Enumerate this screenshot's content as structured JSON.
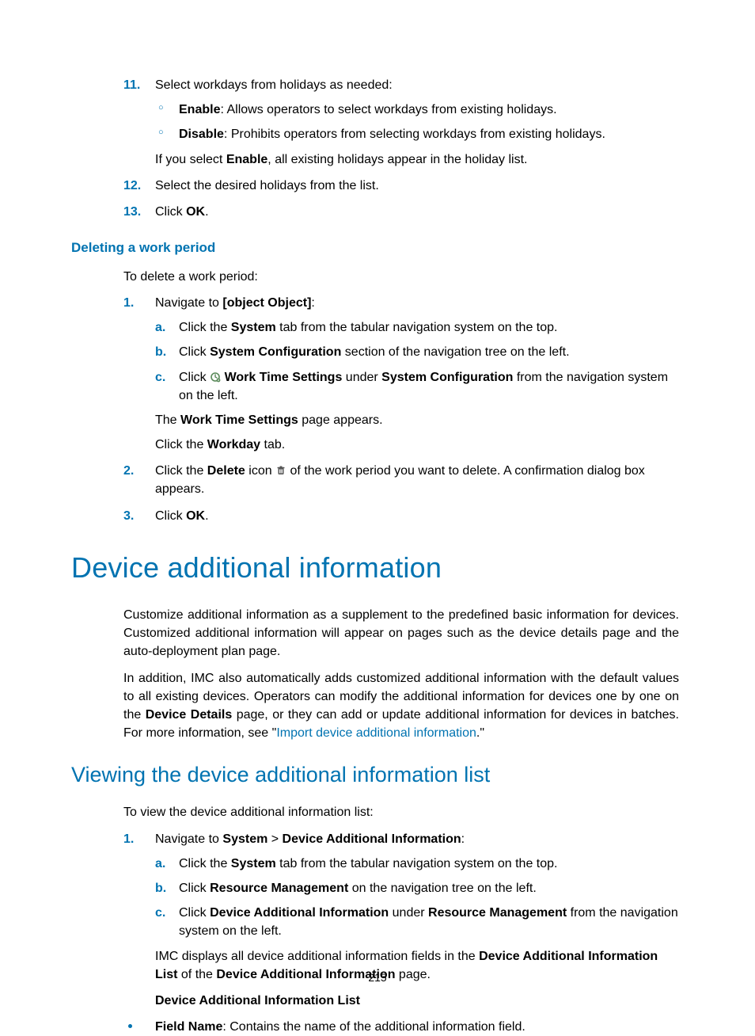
{
  "steps_top": {
    "item11": {
      "num": "11.",
      "lead": "Select workdays from holidays as needed:",
      "enable_b": "Enable",
      "enable_t": ": Allows operators to select workdays from existing holidays.",
      "disable_b": "Disable",
      "disable_t": ": Prohibits operators from selecting workdays from existing holidays.",
      "note_pre": "If you select ",
      "note_b": "Enable",
      "note_post": ", all existing holidays appear in the holiday list."
    },
    "item12": {
      "num": "12.",
      "text": "Select the desired holidays from the list."
    },
    "item13": {
      "num": "13.",
      "pre": "Click ",
      "b": "OK",
      "post": "."
    }
  },
  "deleting": {
    "heading": "Deleting a work period",
    "intro": "To delete a work period:",
    "s1": {
      "num": "1.",
      "pre": "Navigate to ",
      "b": {
        "m": "b.",
        "pre": "Click ",
        "b1": "System Configuration",
        "post": " section of the navigation tree on the left."
      },
      "post": ":",
      "a": {
        "m": "a.",
        "pre": "Click the ",
        "b": "System",
        "post": " tab from the tabular navigation system on the top."
      },
      "c": {
        "m": "c.",
        "pre": "Click ",
        "b1": "Work Time Settings",
        "mid": " under ",
        "b2": "System Configuration",
        "post": " from the navigation system on the left."
      },
      "after1_pre": "The ",
      "after1_b": "Work Time Settings",
      "after1_post": " page appears.",
      "after2_pre": "Click the ",
      "after2_b": "Workday",
      "after2_post": " tab."
    },
    "s2": {
      "num": "2.",
      "pre": "Click the ",
      "b": "Delete",
      "mid": " icon ",
      "post": " of the work period you want to delete. A confirmation dialog box appears."
    },
    "s3": {
      "num": "3.",
      "pre": "Click ",
      "b": "OK",
      "post": "."
    }
  },
  "dai": {
    "h1": "Device additional information",
    "p1": "Customize additional information as a supplement to the predefined basic information for devices. Customized additional information will appear on pages such as the device details page and the auto-deployment plan page.",
    "p2_pre": "In addition, IMC also automatically adds customized additional information with the default values to all existing devices. Operators can modify the additional information for devices one by one on the ",
    "p2_b": "Device Details",
    "p2_mid": " page, or they can add or update additional information for devices in batches. For more information, see \"",
    "p2_link": "Import device additional information",
    "p2_post": ".\""
  },
  "viewing": {
    "h2": "Viewing the device additional information list",
    "intro": "To view the device additional information list:",
    "s1": {
      "num": "1.",
      "pre": "Navigate to ",
      "b1": "System",
      "gt": " > ",
      "b2": "Device Additional Information",
      "post": ":",
      "a": {
        "m": "a.",
        "pre": "Click the ",
        "b": "System",
        "post": " tab from the tabular navigation system on the top."
      },
      "b": {
        "m": "b.",
        "pre": "Click ",
        "b": "Resource Management",
        "post": " on the navigation tree on the left."
      },
      "c": {
        "m": "c.",
        "pre": "Click ",
        "b1": "Device Additional Information",
        "mid": " under ",
        "b2": "Resource Management",
        "post": " from the navigation system on the left."
      },
      "after_pre": "IMC displays all device additional information fields in the ",
      "after_b1": "Device Additional Information List",
      "after_mid": " of the ",
      "after_b2": "Device Additional Information",
      "after_post": " page."
    },
    "list_head": "Device Additional Information List",
    "field_b": "Field Name",
    "field_t": ": Contains the name of the additional information field."
  },
  "page_number": "215"
}
